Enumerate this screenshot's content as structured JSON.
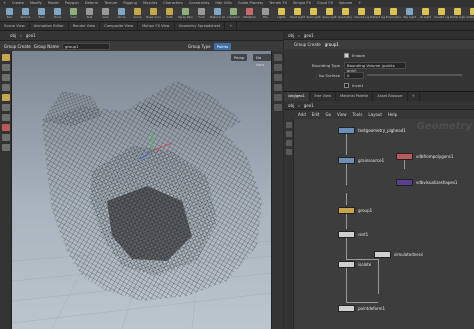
{
  "shelf": {
    "tabs": [
      "+",
      "Create",
      "Modify",
      "Model",
      "Polygon",
      "Deform",
      "Texture",
      "Rigging",
      "Muscles",
      "Characters",
      "Constraints",
      "Hair Utils",
      "Guide Process",
      "Terrain FX",
      "Simple FX",
      "Cloud FX",
      "Volume",
      "+"
    ],
    "tools": [
      {
        "label": "Box",
        "color": "#7fa6c9"
      },
      {
        "label": "Sphere",
        "color": "#7fa6c9"
      },
      {
        "label": "Tube",
        "color": "#7fa6c9"
      },
      {
        "label": "Torus",
        "color": "#7fa6c9"
      },
      {
        "label": "Grid",
        "color": "#8fb07a"
      },
      {
        "label": "Null",
        "color": "#9a9a9a"
      },
      {
        "label": "Line",
        "color": "#9a9a9a"
      },
      {
        "label": "Circle",
        "color": "#7fa6c9"
      },
      {
        "label": "Curve",
        "color": "#c9a64d"
      },
      {
        "label": "Draw Curve",
        "color": "#c9a64d"
      },
      {
        "label": "Path",
        "color": "#c9a64d"
      },
      {
        "label": "Spray Paint",
        "color": "#8fb07a"
      },
      {
        "label": "Font",
        "color": "#9a9a9a"
      },
      {
        "label": "Platonic Solids",
        "color": "#7fa6c9"
      },
      {
        "label": "L-System",
        "color": "#8fb07a"
      },
      {
        "label": "Metaball",
        "color": "#c96a6a"
      },
      {
        "label": "File",
        "color": "#9a9a9a"
      },
      {
        "label": "Lights",
        "color": "#e0c050"
      },
      {
        "label": "Point Light",
        "color": "#e0c050"
      },
      {
        "label": "Spot Light",
        "color": "#e0c050"
      },
      {
        "label": "Area Light",
        "color": "#e0c050"
      },
      {
        "label": "Geometry Light",
        "color": "#e0c050"
      },
      {
        "label": "Volume Light",
        "color": "#e0c050"
      },
      {
        "label": "Distant Light",
        "color": "#e0c050"
      },
      {
        "label": "Environment Light",
        "color": "#e0c050"
      },
      {
        "label": "Sky Light",
        "color": "#7fa6c9"
      },
      {
        "label": "GI Light",
        "color": "#e0c050"
      },
      {
        "label": "Caustic Light",
        "color": "#e0c050"
      },
      {
        "label": "Portal Light",
        "color": "#e0c050"
      },
      {
        "label": "Ambient Light",
        "color": "#e0c050"
      }
    ]
  },
  "pane_tabs": [
    "Scene View",
    "Animation Editor",
    "Render View",
    "Composite View",
    "Motion FX View",
    "Geometry Spreadsheet",
    "+"
  ],
  "viewer": {
    "path": [
      "obj",
      "geo1"
    ],
    "op_label": "Group Create",
    "group_name_label": "Group Name",
    "group_name_value": "group1",
    "group_type_label": "Group Type",
    "group_type_value": "Points",
    "persp_button": "Persp",
    "cam_button": "No cam"
  },
  "params": {
    "path": [
      "obj",
      "geo1"
    ],
    "header_type": "Group Create",
    "header_name": "group1",
    "enable_label": "Enable",
    "bounding_type_label": "Bounding Type",
    "bounding_type_value": "Bounding Volume (points only)",
    "iso_surface_label": "Iso Surface",
    "iso_surface_value": "0",
    "invert_label": "Invert"
  },
  "network": {
    "tabs": [
      "/obj/geo1",
      "Tree View",
      "Material Palette",
      "Asset Browser",
      "+"
    ],
    "path": [
      "obj",
      "geo1"
    ],
    "menu": [
      "Add",
      "Edit",
      "Go",
      "View",
      "Tools",
      "Layout",
      "Help"
    ],
    "context_label": "Geometry",
    "nodes": [
      {
        "name": "testgeometry_pighead1",
        "color": "#6b8fb8"
      },
      {
        "name": "vdbfrompolygons1",
        "color": "#b95b5b"
      },
      {
        "name": "grainsource1",
        "color": "#6b8fb8"
      },
      {
        "name": "vdbvisualizeshapes1",
        "color": "#5a3f8f"
      },
      {
        "name": "group1",
        "color": "#c9a64d"
      },
      {
        "name": "rest1",
        "color": "#cfcfcf"
      },
      {
        "name": "simulatedness",
        "color": "#cfcfcf"
      },
      {
        "name": "isolate",
        "color": "#cfcfcf"
      },
      {
        "name": "pointdeform1",
        "color": "#cfcfcf"
      }
    ]
  }
}
